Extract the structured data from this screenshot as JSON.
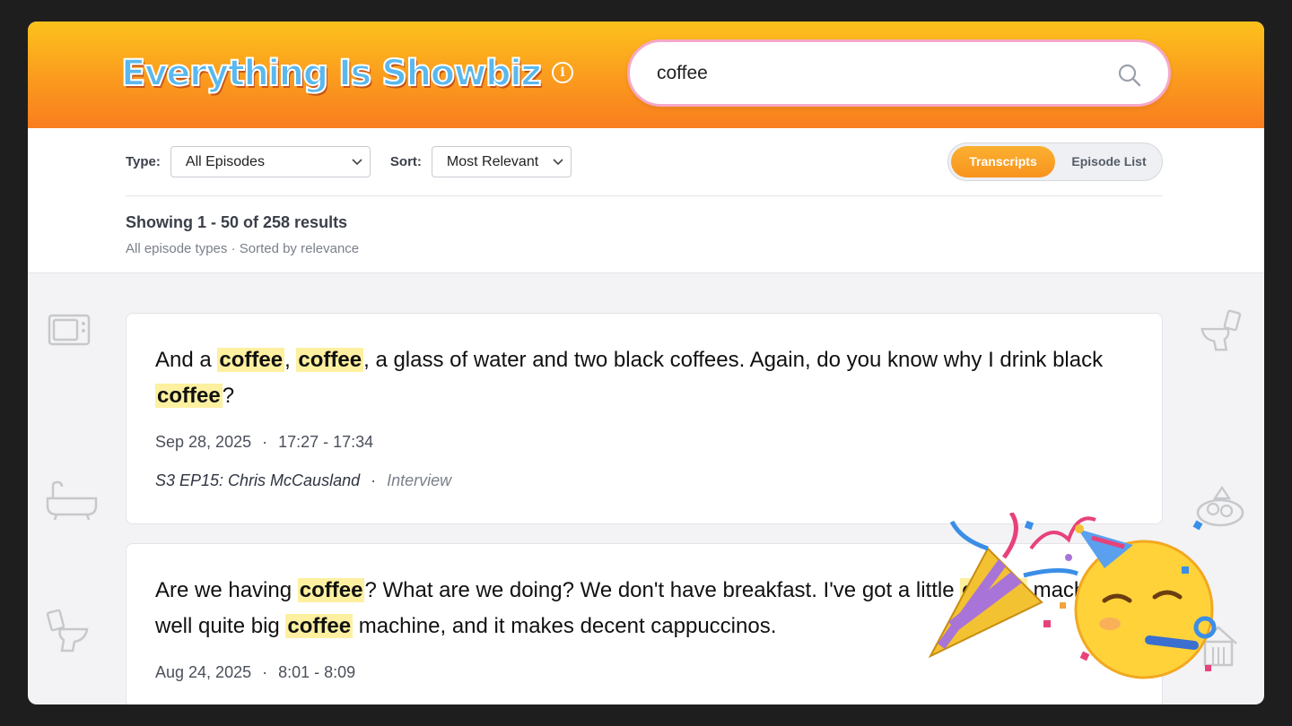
{
  "header": {
    "logo_text": "Everything Is Showbiz",
    "info_icon": "info-icon",
    "search": {
      "value": "coffee",
      "icon": "search-icon"
    }
  },
  "filters": {
    "type_label": "Type:",
    "type_value": "All Episodes",
    "sort_label": "Sort:",
    "sort_value": "Most Relevant",
    "view_toggle": {
      "active": "Transcripts",
      "inactive": "Episode List"
    }
  },
  "results": {
    "count_text": "Showing 1 - 50 of 258 results",
    "sub_text": "All episode types · Sorted by relevance"
  },
  "cards": [
    {
      "quote": [
        {
          "t": "And a "
        },
        {
          "t": "coffee",
          "hl": true
        },
        {
          "t": ", "
        },
        {
          "t": "coffee",
          "hl": true
        },
        {
          "t": ", a glass of water and two black coffees. Again, do you know why I drink black "
        },
        {
          "t": "coffee",
          "hl": true
        },
        {
          "t": "?"
        }
      ],
      "date": "Sep 28, 2025",
      "time_range": "17:27 - 17:34",
      "episode": "S3 EP15: Chris McCausland",
      "episode_type": "Interview"
    },
    {
      "quote": [
        {
          "t": "Are we having "
        },
        {
          "t": "coffee",
          "hl": true
        },
        {
          "t": "? What are we doing? We don't have breakfast. I've got a "
        },
        {
          "t": "little"
        },
        {
          "t": " "
        },
        {
          "t": "coffee",
          "hl": true
        },
        {
          "t": " machine, well quite big "
        },
        {
          "t": "coffee",
          "hl": true
        },
        {
          "t": " machine, and it makes decent cappuccinos."
        }
      ],
      "date": "Aug 24, 2025",
      "time_range": "8:01 - 8:09"
    }
  ],
  "overlay": {
    "emoji": [
      "party-popper-icon",
      "partying-face-icon"
    ]
  },
  "colors": {
    "header_top": "#fcc21c",
    "header_bottom": "#f97d1f",
    "accent": "#f8931e",
    "highlight": "#fdf0a0"
  }
}
